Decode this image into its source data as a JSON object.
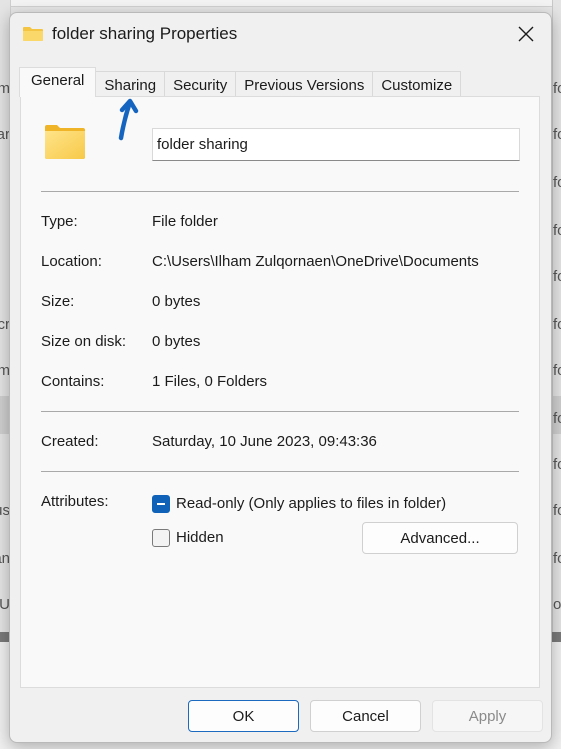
{
  "background": {
    "left_fragments": [
      "m",
      "ar",
      "cr",
      "m",
      "us",
      "an",
      "U"
    ],
    "right_fragments": [
      "fo",
      "fo",
      "fo",
      "fo",
      "fo",
      "fo",
      "fo",
      "fo",
      "fo",
      "fo",
      "fo",
      "o"
    ]
  },
  "dialog": {
    "title": "folder sharing Properties",
    "title_icon": "folder-icon",
    "close_icon": "close-icon"
  },
  "tabs": [
    {
      "label": "General",
      "active": true
    },
    {
      "label": "Sharing",
      "active": false
    },
    {
      "label": "Security",
      "active": false
    },
    {
      "label": "Previous Versions",
      "active": false
    },
    {
      "label": "Customize",
      "active": false
    }
  ],
  "general": {
    "folder_icon": "folder-icon",
    "name_value": "folder sharing",
    "properties": [
      {
        "label": "Type:",
        "value": "File folder"
      },
      {
        "label": "Location:",
        "value": "C:\\Users\\Ilham Zulqornaen\\OneDrive\\Documents"
      },
      {
        "label": "Size:",
        "value": "0 bytes"
      },
      {
        "label": "Size on disk:",
        "value": "0 bytes"
      },
      {
        "label": "Contains:",
        "value": "1 Files, 0 Folders"
      }
    ],
    "created": {
      "label": "Created:",
      "value": "Saturday, 10 June 2023, 09:43:36"
    },
    "attributes": {
      "label": "Attributes:",
      "readonly": {
        "label": "Read-only (Only applies to files in folder)",
        "state": "indeterminate"
      },
      "hidden": {
        "label": "Hidden",
        "state": "unchecked"
      },
      "advanced_label": "Advanced..."
    }
  },
  "footer": {
    "ok_label": "OK",
    "cancel_label": "Cancel",
    "apply_label": "Apply",
    "apply_enabled": false
  },
  "annotation": {
    "type": "arrow",
    "color": "#1565c0",
    "points_to": "Sharing tab"
  }
}
